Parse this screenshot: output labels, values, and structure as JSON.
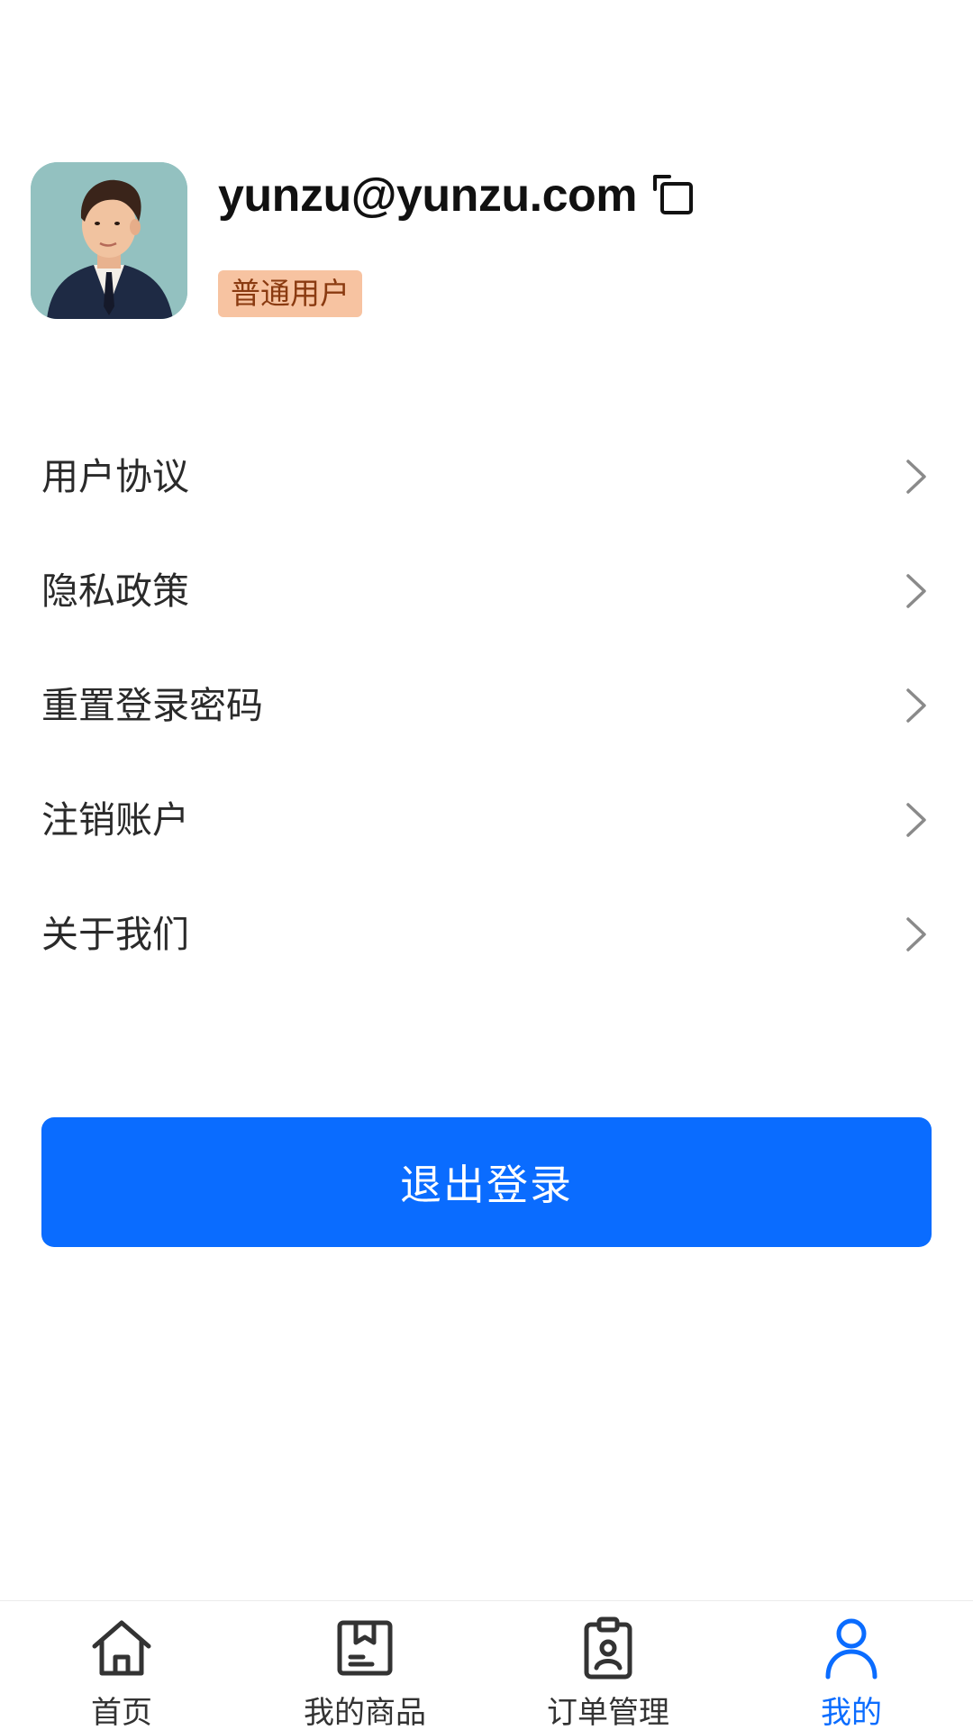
{
  "profile": {
    "email": "yunzu@yunzu.com",
    "role_badge": "普通用户"
  },
  "menu": {
    "items": [
      {
        "label": "用户协议"
      },
      {
        "label": "隐私政策"
      },
      {
        "label": "重置登录密码"
      },
      {
        "label": "注销账户"
      },
      {
        "label": "关于我们"
      }
    ]
  },
  "logout_label": "退出登录",
  "tabbar": {
    "tabs": [
      {
        "label": "首页",
        "icon": "home-icon"
      },
      {
        "label": "我的商品",
        "icon": "product-box-icon"
      },
      {
        "label": "订单管理",
        "icon": "order-clipboard-icon"
      },
      {
        "label": "我的",
        "icon": "user-icon",
        "active": true
      }
    ]
  },
  "colors": {
    "accent": "#0a6cff",
    "badge_bg": "#f7c3a1",
    "badge_text": "#8a3a10",
    "avatar_bg": "#93c1c0"
  }
}
